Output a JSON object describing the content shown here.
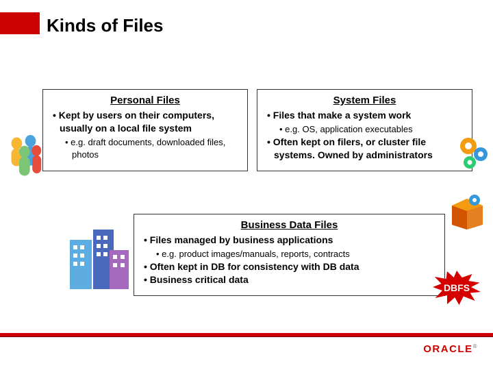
{
  "title": "Kinds of Files",
  "cards": {
    "personal": {
      "heading": "Personal Files",
      "b1": "Kept by users on their computers, usually on a local file system",
      "b1a": "e.g. draft documents, downloaded files, photos"
    },
    "system": {
      "heading": "System Files",
      "b1": "Files that make a system work",
      "b1a": "e.g. OS, application executables",
      "b2": "Often kept on filers, or cluster file systems.  Owned by administrators"
    },
    "business": {
      "heading": "Business Data Files",
      "b1": "Files managed by business applications",
      "b1a": "e.g. product images/manuals, reports, contracts",
      "b2": "Often kept in DB for consistency with DB data",
      "b3": "Business critical data"
    }
  },
  "badge": "DBFS",
  "logo": "ORACLE",
  "icons": {
    "people": "people-icon",
    "gears": "gears-icon",
    "box": "software-box-icon",
    "buildings": "buildings-icon",
    "starburst": "starburst-badge"
  }
}
